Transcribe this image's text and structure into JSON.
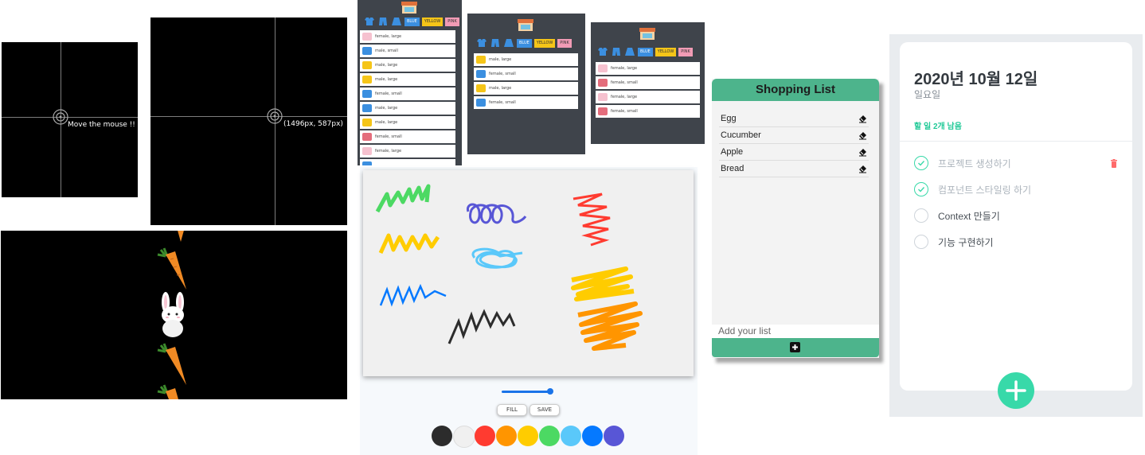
{
  "crosshair_small": {
    "text": "Move the mouse !!"
  },
  "crosshair_large": {
    "text": "(1496px, 587px)"
  },
  "shop_panels": [
    {
      "filters": [
        "BLUE",
        "YELLOW",
        "PINK"
      ],
      "items": [
        {
          "label": "female, large",
          "color": "#f6c1cf"
        },
        {
          "label": "male, small",
          "color": "#3b8fe0"
        },
        {
          "label": "male, large",
          "color": "#f5c518"
        },
        {
          "label": "male, large",
          "color": "#f5c518"
        },
        {
          "label": "female, small",
          "color": "#3b8fe0"
        },
        {
          "label": "male, large",
          "color": "#3b8fe0"
        },
        {
          "label": "male, large",
          "color": "#f5c518"
        },
        {
          "label": "female, small",
          "color": "#e46d7c"
        },
        {
          "label": "female, large",
          "color": "#f6c1cf"
        },
        {
          "label": "",
          "color": "#3b8fe0"
        }
      ]
    },
    {
      "filters": [
        "BLUE",
        "YELLOW",
        "PINK"
      ],
      "items": [
        {
          "label": "male, large",
          "color": "#f5c518"
        },
        {
          "label": "female, small",
          "color": "#3b8fe0"
        },
        {
          "label": "male, large",
          "color": "#f5c518"
        },
        {
          "label": "female, small",
          "color": "#3b8fe0"
        }
      ]
    },
    {
      "filters": [
        "BLUE",
        "YELLOW",
        "PINK"
      ],
      "items": [
        {
          "label": "female, large",
          "color": "#f6c1cf"
        },
        {
          "label": "female, small",
          "color": "#e46d7c"
        },
        {
          "label": "female, large",
          "color": "#f6c1cf"
        },
        {
          "label": "female, small",
          "color": "#e46d7c"
        }
      ]
    }
  ],
  "paint": {
    "buttons": {
      "fill": "FILL",
      "save": "SAVE"
    },
    "brush_size": 0.95,
    "colors": [
      "#2c2c2c",
      "#f0f0f0",
      "#ff3b30",
      "#ff9500",
      "#ffcc00",
      "#4cd963",
      "#5ac8fa",
      "#0579ff",
      "#5856d6"
    ]
  },
  "shopping_list": {
    "title": "Shopping List",
    "items": [
      "Egg",
      "Cucumber",
      "Apple",
      "Bread"
    ],
    "placeholder": "Add your list"
  },
  "todo": {
    "date": "2020년 10월 12일",
    "day": "일요일",
    "tasks_left": "할 일 2개 남음",
    "items": [
      {
        "text": "프로젝트 생성하기",
        "done": true
      },
      {
        "text": "컴포넌트 스타일링 하기",
        "done": true
      },
      {
        "text": "Context 만들기",
        "done": false
      },
      {
        "text": "기능 구현하기",
        "done": false
      }
    ]
  }
}
